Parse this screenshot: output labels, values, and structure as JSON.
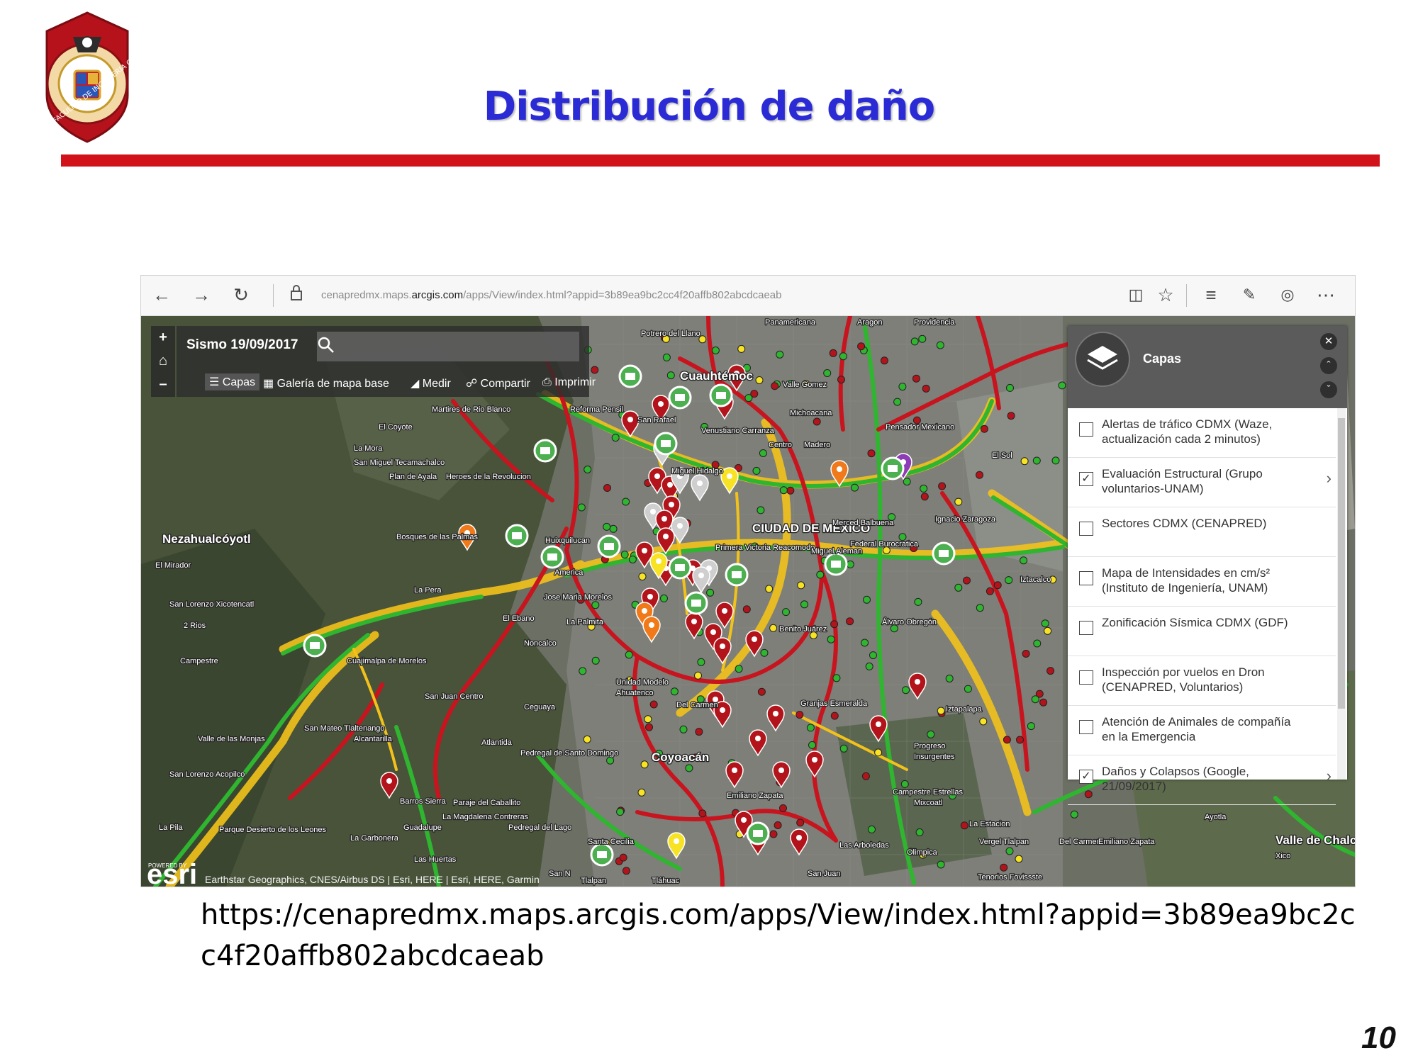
{
  "slide": {
    "title": "Distribución de daño",
    "logo": {
      "icon": "university-seal-icon",
      "text_top": "MICHOACANA",
      "text_bottom": "FACULTAD DE INGENIERIA CIVIL"
    },
    "caption_url": "https://cenapredmx.maps.arcgis.com/apps/View/index.html?appid=3b89ea9bc2cc4f20affb802abcdcaeab",
    "page_number": "10"
  },
  "browser": {
    "url_prefix": "cenapredmx.maps.",
    "url_domain": "arcgis.com",
    "url_path": "/apps/View/index.html?appid=3b89ea9bc2cc4f20affb802abcdcaeab",
    "icons": [
      "back-icon",
      "forward-icon",
      "refresh-icon",
      "lock-icon",
      "reading-view-icon",
      "favorite-star-icon",
      "hub-icon",
      "web-note-icon",
      "share-icon",
      "more-icon"
    ]
  },
  "map_app": {
    "title": "Sismo 19/09/2017",
    "search_placeholder": "",
    "tools": {
      "layers": "Capas",
      "basemap": "Galería de mapa base",
      "measure": "Medir",
      "share": "Compartir",
      "print": "Imprimir"
    },
    "layers_panel": {
      "title": "Capas",
      "items": [
        {
          "label": "Alertas de tráfico CDMX (Waze, actualización cada 2 minutos)",
          "checked": false,
          "expandable": false
        },
        {
          "label": "Evaluación Estructural (Grupo voluntarios-UNAM)",
          "checked": true,
          "expandable": true
        },
        {
          "label": "Sectores CDMX (CENAPRED)",
          "checked": false,
          "expandable": false
        },
        {
          "label": "Mapa de Intensidades en cm/s² (Instituto de Ingeniería, UNAM)",
          "checked": false,
          "expandable": false
        },
        {
          "label": "Zonificación Sísmica CDMX (GDF)",
          "checked": false,
          "expandable": false
        },
        {
          "label": "Inspección por vuelos en Dron (CENAPRED, Voluntarios)",
          "checked": false,
          "expandable": false
        },
        {
          "label": "Atención de Animales de compañía en la Emergencia",
          "checked": false,
          "expandable": false
        },
        {
          "label": "Daños y Colapsos (Google, 21/09/2017)",
          "checked": true,
          "expandable": true
        }
      ]
    },
    "attribution": "Earthstar Geographics, CNES/Airbus DS | Esri, HERE | Esri, HERE, Garmin",
    "esri_powered": "POWERED BY",
    "esri_logo": "esri",
    "colors": {
      "traffic_heavy": "#c8141e",
      "traffic_medium": "#f2c21b",
      "traffic_free": "#2fb52f",
      "marker_damage": "#b3141b",
      "marker_review": "#f7e324",
      "marker_safe": "#cfcfcf",
      "marker_orange": "#f07a1a"
    },
    "places": [
      "Panamericana",
      "Aragon",
      "Providencia",
      "Potrero del Llano",
      "Cuauhtémoc",
      "Valle Gomez",
      "Michoacana",
      "Pensador Mexicano",
      "El Sol",
      "San Rafael",
      "Venustiano Carranza",
      "Centro",
      "Madero",
      "Reforma Pensil",
      "Martires de Rio Blanco",
      "La Mora",
      "El Coyote",
      "Plan de Ayala",
      "Heroes de la Revolucion",
      "San Miguel Tecamachalco",
      "Miguel Hidalgo",
      "CIUDAD DE MÉXICO",
      "Merced Balbuena",
      "Ignacio Zaragoza",
      "Nezahualcóyotl",
      "Federal Burocratica",
      "El Mirador",
      "Bosques de las Palmas",
      "Huixquilucan",
      "America",
      "Primera Victoria Reacomodo",
      "Miguel Aleman",
      "Iztacalco",
      "San Lorenzo Xicotencatl",
      "La Pera",
      "Jose Maria Morelos",
      "La Palmita",
      "Benito Juárez",
      "Sideral",
      "2 Rios",
      "El Ebano",
      "Álvaro Obregón",
      "Noncalco",
      "Unidad Modelo",
      "Ahuatenco",
      "Campestre",
      "San Juan Centro",
      "Cuajimalpa de Morelos",
      "Ceguaya",
      "Del Carmen",
      "Granjas Esmeralda",
      "Iztapalapa",
      "Valle de las Monjas",
      "San Mateo Tlaltenango",
      "Alcantarilla",
      "Atlantida",
      "Progreso",
      "Pedregal de Santo Domingo",
      "Coyoacán",
      "Insurgentes",
      "San Lorenzo Acopilco",
      "Paraje del Caballito",
      "Barros Sierra",
      "La Magdalena Contreras",
      "Emiliano Zapata",
      "Campestre Estrellas",
      "Mixcoatl",
      "La Estacion",
      "Ayotla",
      "La Pila",
      "Parque Desierto de los Leones",
      "La Garbonera",
      "Guadalupe",
      "Pedregal del Lago",
      "Olimpica",
      "Vergel Tlalpan",
      "Santa Cecilia",
      "Las Arboledas",
      "Del Carmen",
      "Emiliano Zapata",
      "Valle de Chalco Solidaridad",
      "Xico",
      "Las Huertas",
      "San N",
      "Tlalpan",
      "Tenorios Fovissste",
      "San Juan",
      "Tláhuac",
      "Juárez"
    ]
  }
}
